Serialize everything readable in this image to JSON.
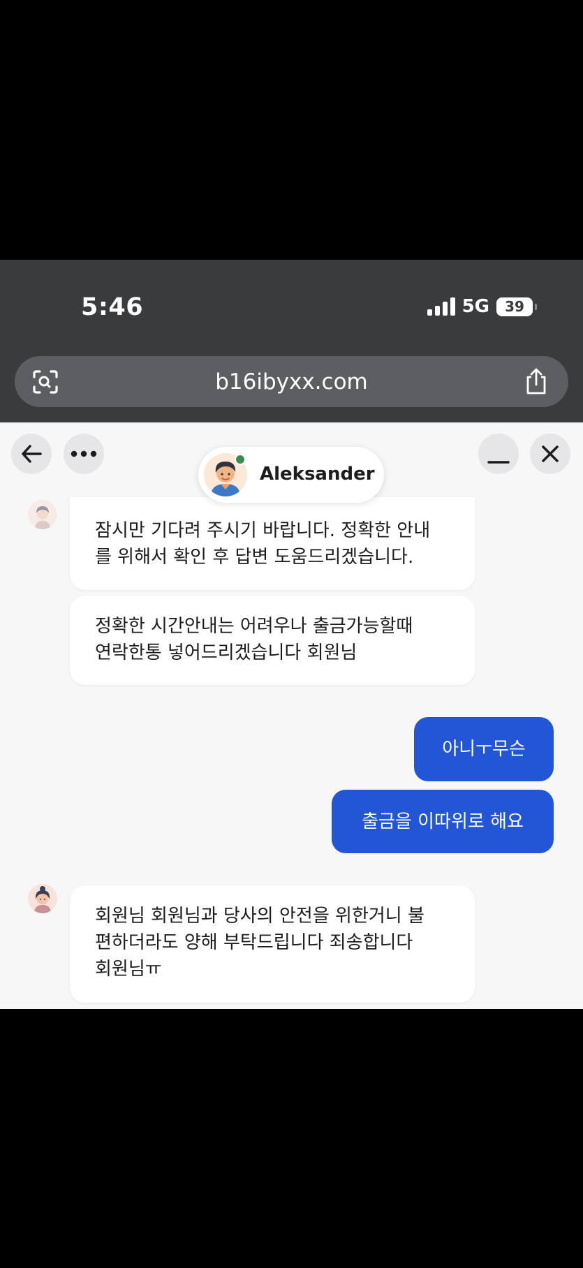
{
  "status_bar": {
    "time": "5:46",
    "network": "5G",
    "battery": "39"
  },
  "browser": {
    "url": "b16ibyxx.com"
  },
  "chat_header": {
    "agent_name": "Aleksander"
  },
  "messages": [
    {
      "from": "agent",
      "text_lines": [
        "잠시만 기다려 주시기 바랍니다. 정확한 안내",
        "를 위해서 확인 후 답변 도움드리겠습니다."
      ]
    },
    {
      "from": "agent",
      "text_lines": [
        "정확한 시간안내는 어려우나 출금가능할때",
        "연락한통 넣어드리겠습니다 회원님"
      ]
    },
    {
      "from": "user",
      "text": "아니ㅜ무슨"
    },
    {
      "from": "user",
      "text": "출금을 이따위로 해요"
    },
    {
      "from": "agent",
      "text_lines": [
        "회원님 회원님과 당사의 안전을 위한거니 불",
        "편하더라도 양해 부탁드립니다 죄송합니다",
        "회원님ㅠ"
      ]
    }
  ],
  "colors": {
    "user_bubble": "#2356d6",
    "chat_background": "#f7f7f8",
    "online_indicator": "#3c8a4f"
  },
  "icons": [
    "back-arrow-icon",
    "more-dots-icon",
    "minimize-icon",
    "close-icon",
    "visual-lookup-icon",
    "share-icon"
  ]
}
